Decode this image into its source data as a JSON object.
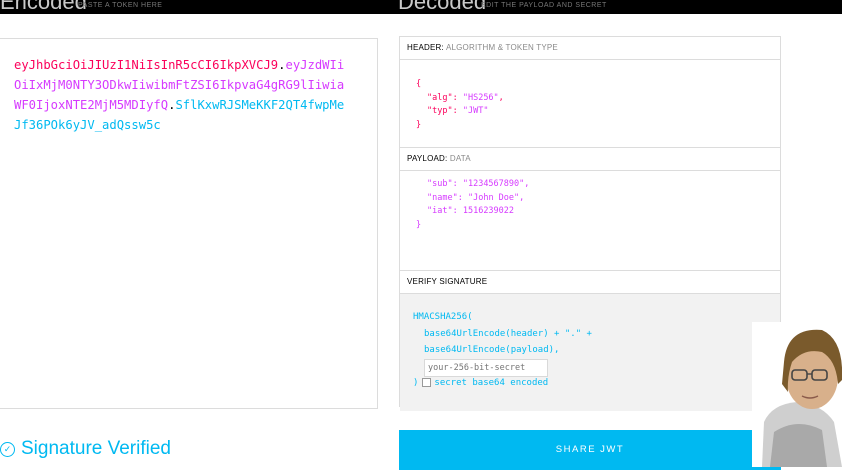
{
  "top": {
    "encoded_title": "Encoded",
    "encoded_sub": "PASTE A TOKEN HERE",
    "decoded_title": "Decoded",
    "decoded_sub": "EDIT THE PAYLOAD AND SECRET"
  },
  "token": {
    "header": "eyJhbGciOiJIUzI1NiIsInR5cCI6IkpXVCJ9",
    "payload": "eyJzdWIiOiIxMjM0NTY3ODkwIiwibmFtZSI6IkpvaG4gRG9lIiwiaWF0IjoxNTE2MjM5MDIyfQ",
    "signature": "SflKxwRJSMeKKF2QT4fwpMeJf36POk6yJV_adQssw5c",
    "dot": "."
  },
  "status": {
    "label": "Signature Verified",
    "check_glyph": "✓"
  },
  "header_section": {
    "title": "HEADER:",
    "subtitle": "ALGORITHM & TOKEN TYPE",
    "open": "{",
    "close": "}",
    "lines": [
      {
        "key": "\"alg\"",
        "value": "\"HS256\"",
        "sep": ": ",
        "trail": ","
      },
      {
        "key": "\"typ\"",
        "value": "\"JWT\"",
        "sep": ": ",
        "trail": ""
      }
    ]
  },
  "payload_section": {
    "title": "PAYLOAD:",
    "subtitle": "DATA",
    "close": "}",
    "lines": [
      {
        "key": "\"sub\"",
        "value": "\"1234567890\"",
        "sep": ": ",
        "trail": ","
      },
      {
        "key": "\"name\"",
        "value": "\"John Doe\"",
        "sep": ": ",
        "trail": ","
      },
      {
        "key": "\"iat\"",
        "value": "1516239022",
        "sep": ": ",
        "trail": ""
      }
    ]
  },
  "verify_section": {
    "title": "VERIFY SIGNATURE",
    "line1": "HMACSHA256(",
    "line2": "base64UrlEncode(header) + \".\" +",
    "line3": "base64UrlEncode(payload),",
    "secret_placeholder": "your-256-bit-secret",
    "close_paren": ")",
    "checkbox_label": "secret base64 encoded"
  },
  "share_label": "SHARE JWT",
  "colors": {
    "header": "#fb015b",
    "payload": "#d63aff",
    "signature": "#00b9f1",
    "share_bg": "#00b9f1"
  }
}
